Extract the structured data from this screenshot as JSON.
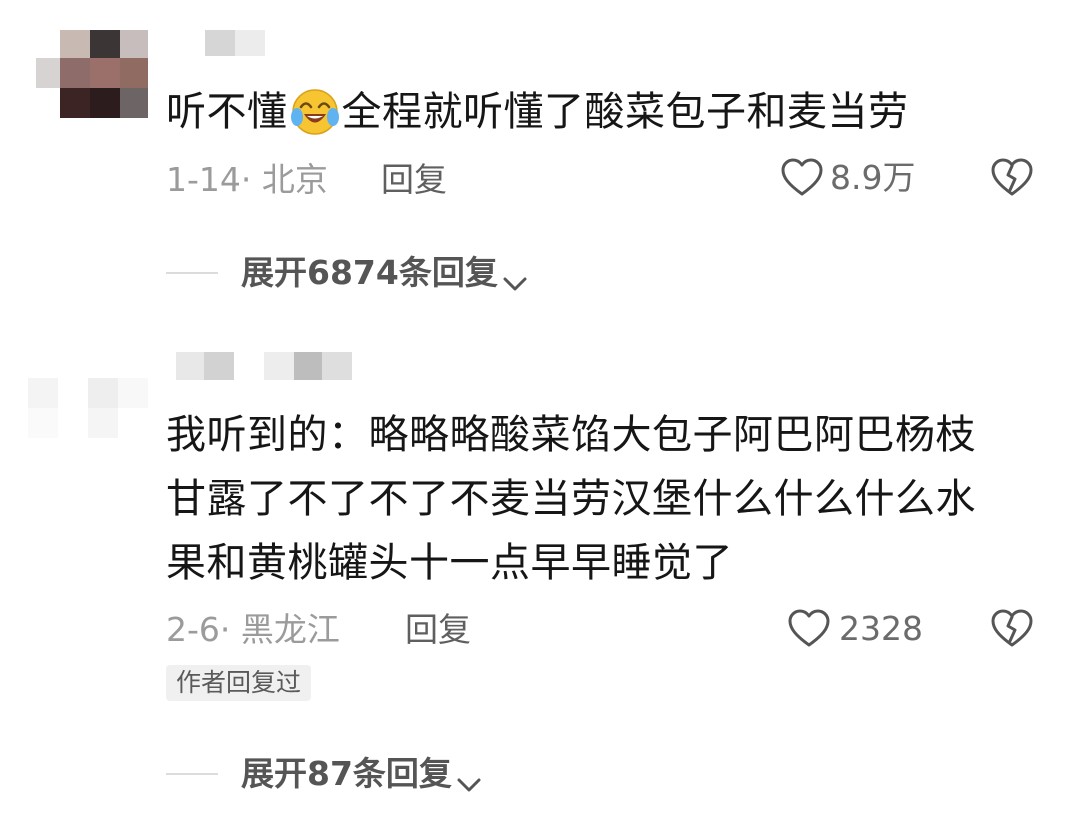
{
  "comments": [
    {
      "text_before_emoji": "听不懂",
      "emoji": "crying-laughing-emoji",
      "text_after_emoji": "全程就听懂了酸菜包子和麦当劳",
      "date": "1-14",
      "location": "北京",
      "reply_label": "回复",
      "like_count": "8.9万",
      "expand_label": "展开6874条回复"
    },
    {
      "lines": [
        "我听到的：略略略酸菜馅大包子阿巴阿巴杨枝",
        "甘露了不了不了不麦当劳汉堡什么什么什么水",
        "果和黄桃罐头十一点早早睡觉了"
      ],
      "date": "2-6",
      "location": "黑龙江",
      "reply_label": "回复",
      "like_count": "2328",
      "author_badge": "作者回复过",
      "expand_label": "展开87条回复"
    }
  ],
  "colors": {
    "text": "#161616",
    "meta": "#9b9b9b",
    "icon": "#555555"
  }
}
